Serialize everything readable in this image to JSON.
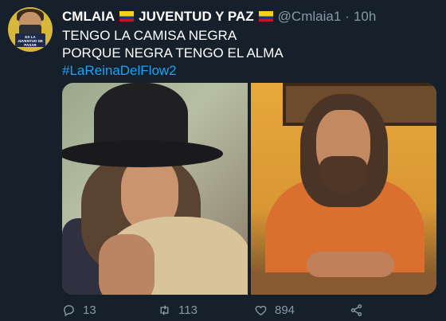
{
  "tweet": {
    "author_name": "CMLAIA",
    "name_suffix": "JUVENTUD Y PAZ",
    "handle": "@Cmlaia1",
    "separator": "·",
    "time": "10h",
    "text_lines": [
      "TENGO LA CAMISA NEGRA",
      "PORQUE NEGRA TENGO EL ALMA"
    ],
    "hashtag": "#LaReinaDelFlow2",
    "avatar_sign_text": "ES LA JUVENTUD DE PASAR",
    "media": [
      {
        "icon": "photo-man-in-hat-hugging"
      },
      {
        "icon": "photo-man-orange-shirt"
      }
    ],
    "actions": {
      "reply_count": "13",
      "retweet_count": "113",
      "like_count": "894"
    },
    "colors": {
      "background": "#15202b",
      "text": "#ffffff",
      "secondary": "#8899a6",
      "link": "#1da1f2"
    }
  }
}
